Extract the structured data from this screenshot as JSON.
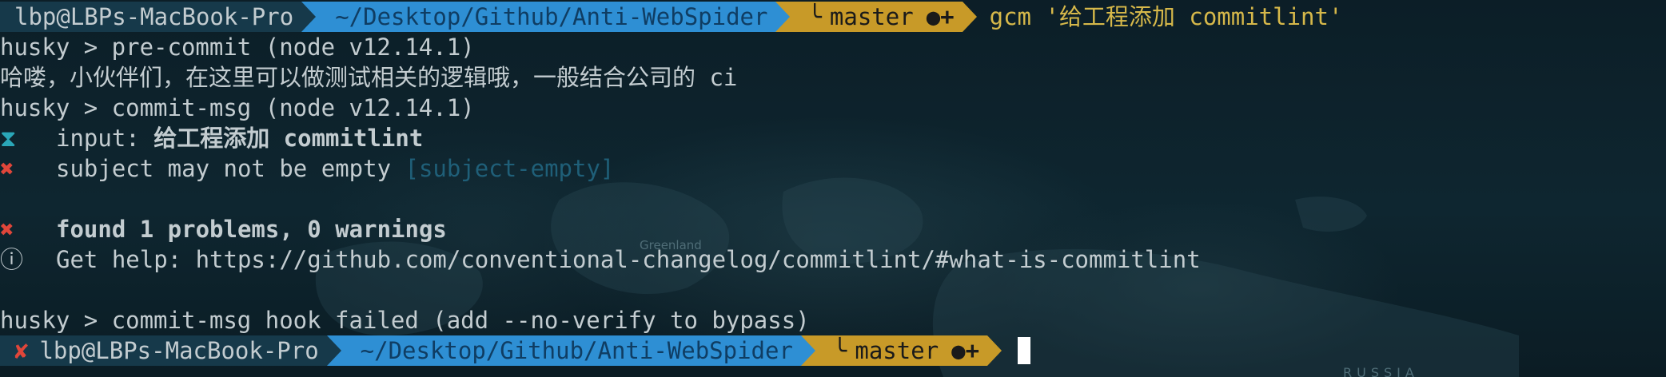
{
  "window": {
    "type": "terminal"
  },
  "prompt1": {
    "user_host": "lbp@LBPs-MacBook-Pro",
    "path": "~/Desktop/Github/Anti-WebSpider",
    "branch_icon": "╰",
    "branch": "master",
    "status": "●+",
    "command": "gcm '给工程添加 commitlint'"
  },
  "output": {
    "line1": "husky > pre-commit (node v12.14.1)",
    "line2": "哈喽，小伙伴们，在这里可以做测试相关的逻辑哦，一般结合公司的 ci",
    "line3": "husky > commit-msg (node v12.14.1)",
    "input_icon": "⧗",
    "input_label": "input: ",
    "input_value": "给工程添加 commitlint",
    "error_icon": "✖",
    "subject_error": "subject may not be empty ",
    "subject_rule": "[subject-empty]",
    "found_icon": "✖",
    "found_text": "found 1 problems, 0 warnings",
    "help_icon": "ⓘ",
    "help_text": "Get help: https://github.com/conventional-changelog/commitlint/#what-is-commitlint",
    "hook_failed": "husky > commit-msg hook failed (add --no-verify to bypass)"
  },
  "prompt2": {
    "error_mark": "✘",
    "user_host": "lbp@LBPs-MacBook-Pro",
    "path": "~/Desktop/Github/Anti-WebSpider",
    "branch_icon": "╰",
    "branch": "master",
    "status": "●+"
  },
  "map_labels": {
    "greenland": "Greenland",
    "russia": "RUSSIA"
  },
  "colors": {
    "background": "#0b1c24",
    "segment_user": "#16394a",
    "segment_path": "#2e8fd4",
    "segment_git": "#c89a28",
    "command_text": "#d6b84a",
    "error_red": "#e0463a",
    "input_icon_teal": "#2aa7b8"
  }
}
